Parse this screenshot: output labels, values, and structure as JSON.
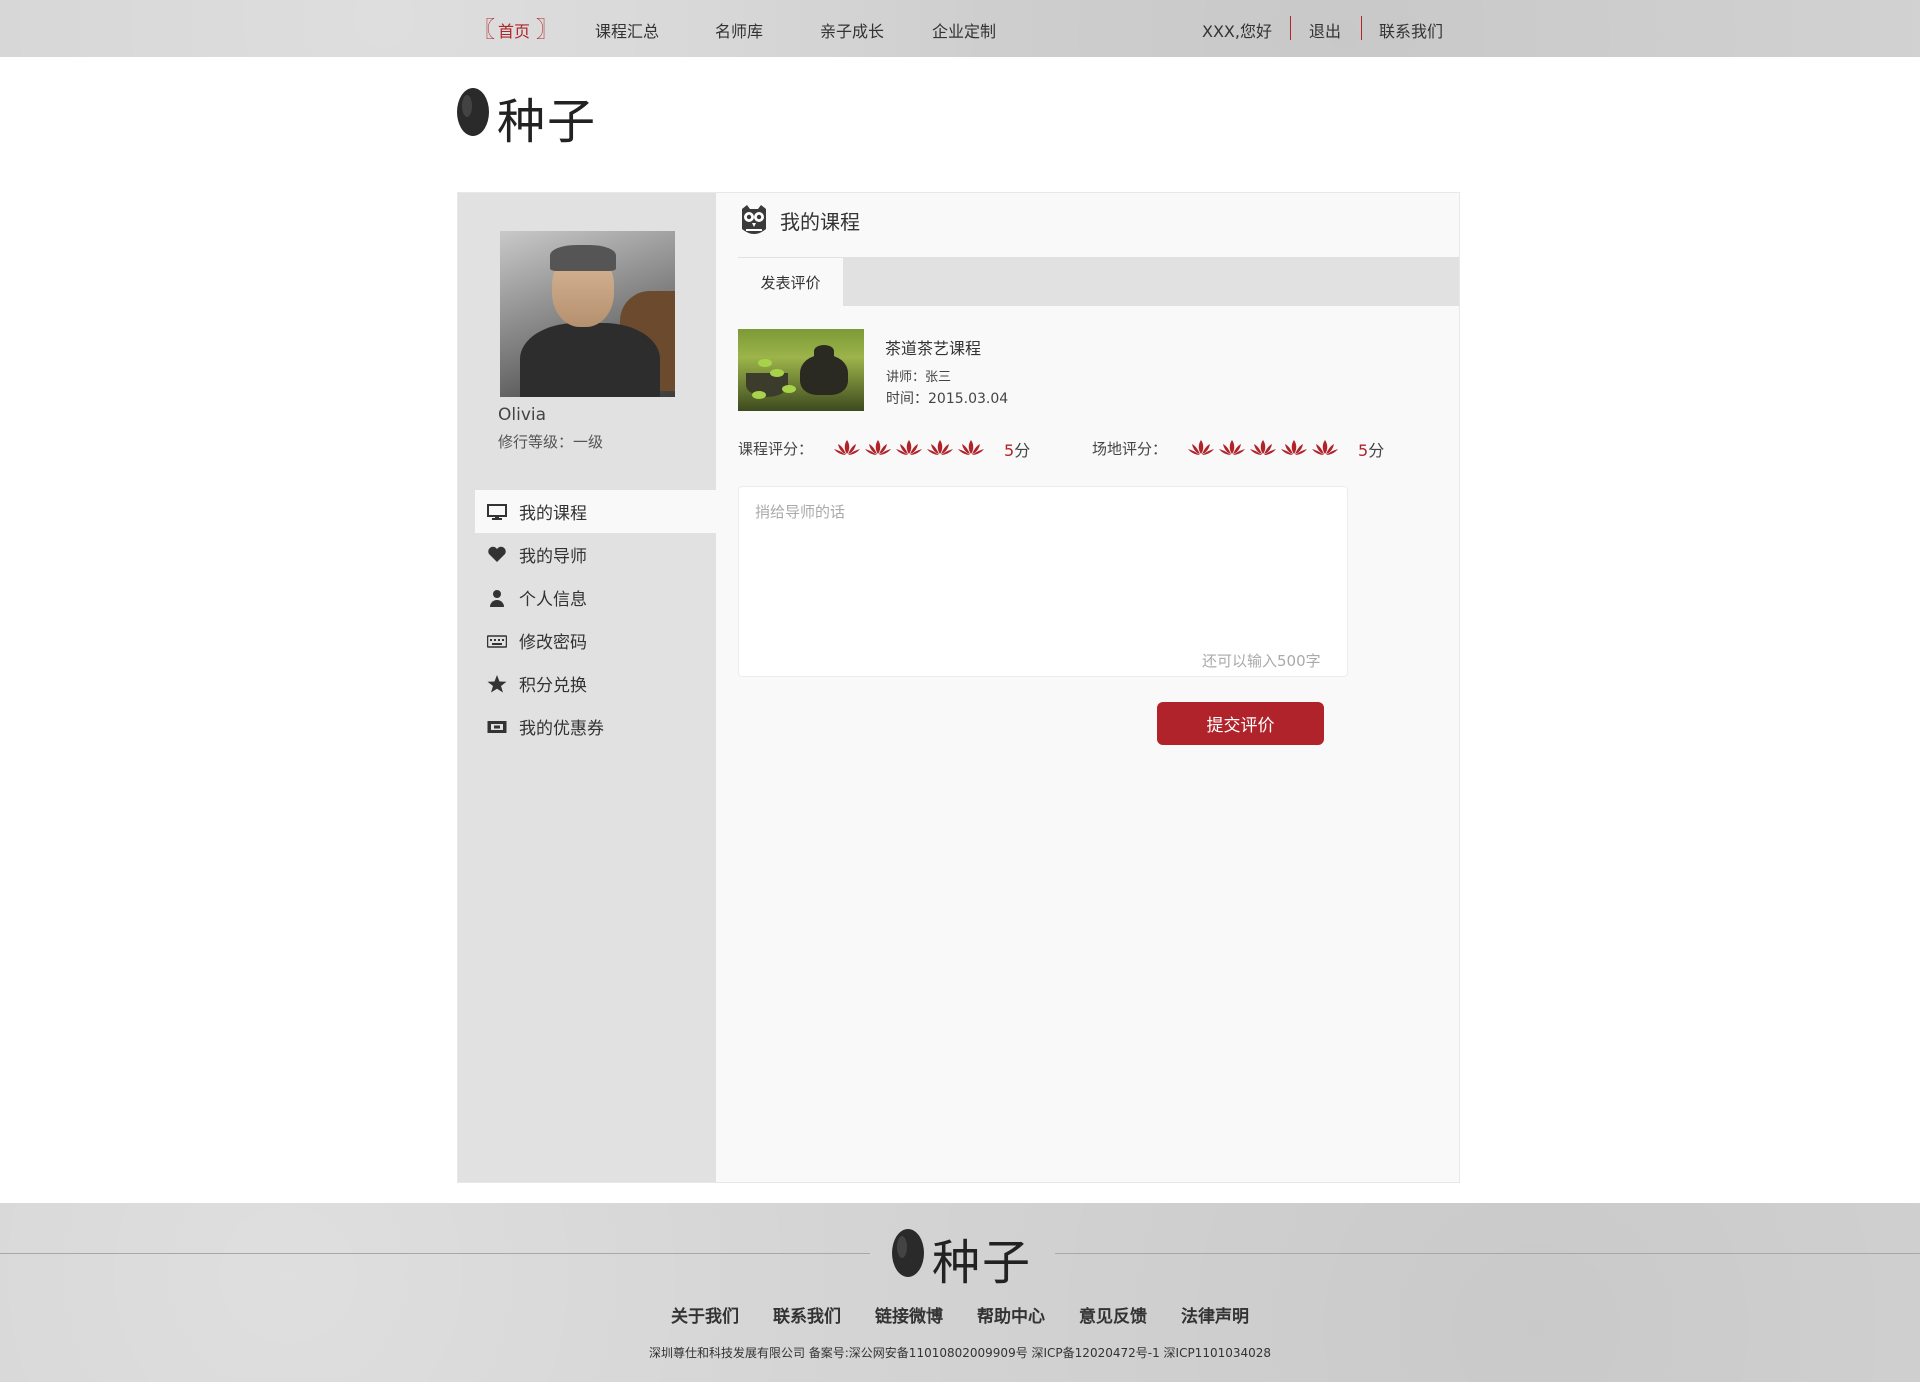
{
  "nav": {
    "home": "首页",
    "courses": "课程汇总",
    "teachers": "名师库",
    "parenting": "亲子成长",
    "enterprise": "企业定制",
    "greeting": "XXX,您好",
    "logout": "退出",
    "contact": "联系我们"
  },
  "logo": {
    "text": "种子"
  },
  "profile": {
    "name": "Olivia",
    "level": "修行等级：一级"
  },
  "sidebar": {
    "items": [
      {
        "label": "我的课程",
        "icon": "monitor-icon",
        "active": true
      },
      {
        "label": "我的导师",
        "icon": "heart-icon",
        "active": false
      },
      {
        "label": "个人信息",
        "icon": "user-icon",
        "active": false
      },
      {
        "label": "修改密码",
        "icon": "keyboard-icon",
        "active": false
      },
      {
        "label": "积分兑换",
        "icon": "star-icon",
        "active": false
      },
      {
        "label": "我的优惠券",
        "icon": "coupon-icon",
        "active": false
      }
    ]
  },
  "content": {
    "title": "我的课程",
    "tab": "发表评价"
  },
  "course": {
    "name": "茶道茶艺课程",
    "teacher": "讲师：张三",
    "time": "时间：2015.03.04"
  },
  "ratings": {
    "course_label": "课程评分：",
    "course_score": 5,
    "venue_label": "场地评分：",
    "venue_score": 5,
    "max_score": 5,
    "unit": "分"
  },
  "comment": {
    "placeholder": "捎给导师的话",
    "value": "",
    "remain": "还可以输入500字"
  },
  "submit_label": "提交评价",
  "footer": {
    "links": [
      "关于我们",
      "联系我们",
      "链接微博",
      "帮助中心",
      "意见反馈",
      "法律声明"
    ],
    "copyright": "深圳尊仕和科技发展有限公司 备案号:深公网安备110108020099​09号 深ICP备12020472号-1 深ICP1101034028"
  },
  "colors": {
    "accent": "#b0232a",
    "sidebar_bg": "#e1e1e1",
    "topbar_bg": "#d3d3d3"
  }
}
